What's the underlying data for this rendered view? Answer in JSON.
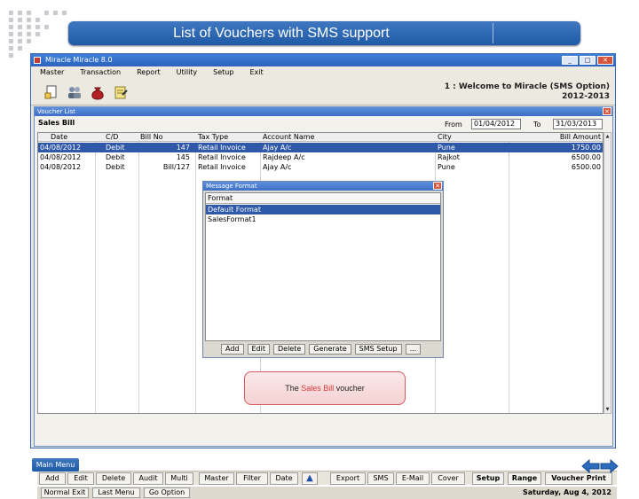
{
  "slide": {
    "title": "List of Vouchers with SMS support",
    "main_menu": "Main Menu"
  },
  "app": {
    "title": "Miracle Miracle 8.0",
    "menu": [
      "Master",
      "Transaction",
      "Report",
      "Utility",
      "Setup",
      "Exit"
    ],
    "welcome_line1": "1 : Welcome to Miracle (SMS Option)",
    "welcome_line2": "2012-2013",
    "toolbar_icons": [
      "new-document-icon",
      "users-icon",
      "money-bag-icon",
      "notepad-icon"
    ]
  },
  "voucher_list": {
    "window_title": "Voucher List",
    "voucher_type": "Sales Bill",
    "from_label": "From",
    "from_date": "01/04/2012",
    "to_label": "To",
    "to_date": "31/03/2013",
    "columns": [
      "Date",
      "C/D",
      "Bill No",
      "Tax Type",
      "Account Name",
      "City",
      "Bill Amount"
    ],
    "rows": [
      {
        "date": "04/08/2012",
        "cd": "Debit",
        "bill_no": "147",
        "tax_type": "Retail Invoice",
        "account": "Ajay A/c",
        "city": "Pune",
        "amount": "1750.00",
        "selected": true
      },
      {
        "date": "04/08/2012",
        "cd": "Debit",
        "bill_no": "145",
        "tax_type": "Retail Invoice",
        "account": "Rajdeep A/c",
        "city": "Rajkot",
        "amount": "6500.00",
        "selected": false
      },
      {
        "date": "04/08/2012",
        "cd": "Debit",
        "bill_no": "Bill/127",
        "tax_type": "Retail Invoice",
        "account": "Ajay A/c",
        "city": "Pune",
        "amount": "6500.00",
        "selected": false
      }
    ]
  },
  "message_format": {
    "title": "Message Format",
    "header": "Format",
    "items": [
      {
        "label": "Default Format",
        "selected": true
      },
      {
        "label": "SalesFormat1",
        "selected": false
      }
    ],
    "buttons": [
      "Add",
      "Edit",
      "Delete",
      "Generate",
      "SMS Setup",
      "..."
    ]
  },
  "callout": {
    "prefix": "The ",
    "highlight": "Sales Bill",
    "suffix": " voucher"
  },
  "bottom_toolbar": {
    "buttons": [
      "Add",
      "Edit",
      "Delete",
      "Audit",
      "Multi",
      "Master",
      "Filter",
      "Date",
      "Export",
      "SMS",
      "E-Mail",
      "Cover",
      "Setup",
      "Range",
      "Voucher Print"
    ]
  },
  "status_bar": {
    "buttons": [
      "Normal Exit",
      "Last Menu",
      "Go Option"
    ],
    "date": "Saturday, Aug 4, 2012"
  },
  "colors": {
    "title_blue": "#1f5aa6",
    "selection_blue": "#2f59a8",
    "callout_red": "#d23a3a"
  }
}
